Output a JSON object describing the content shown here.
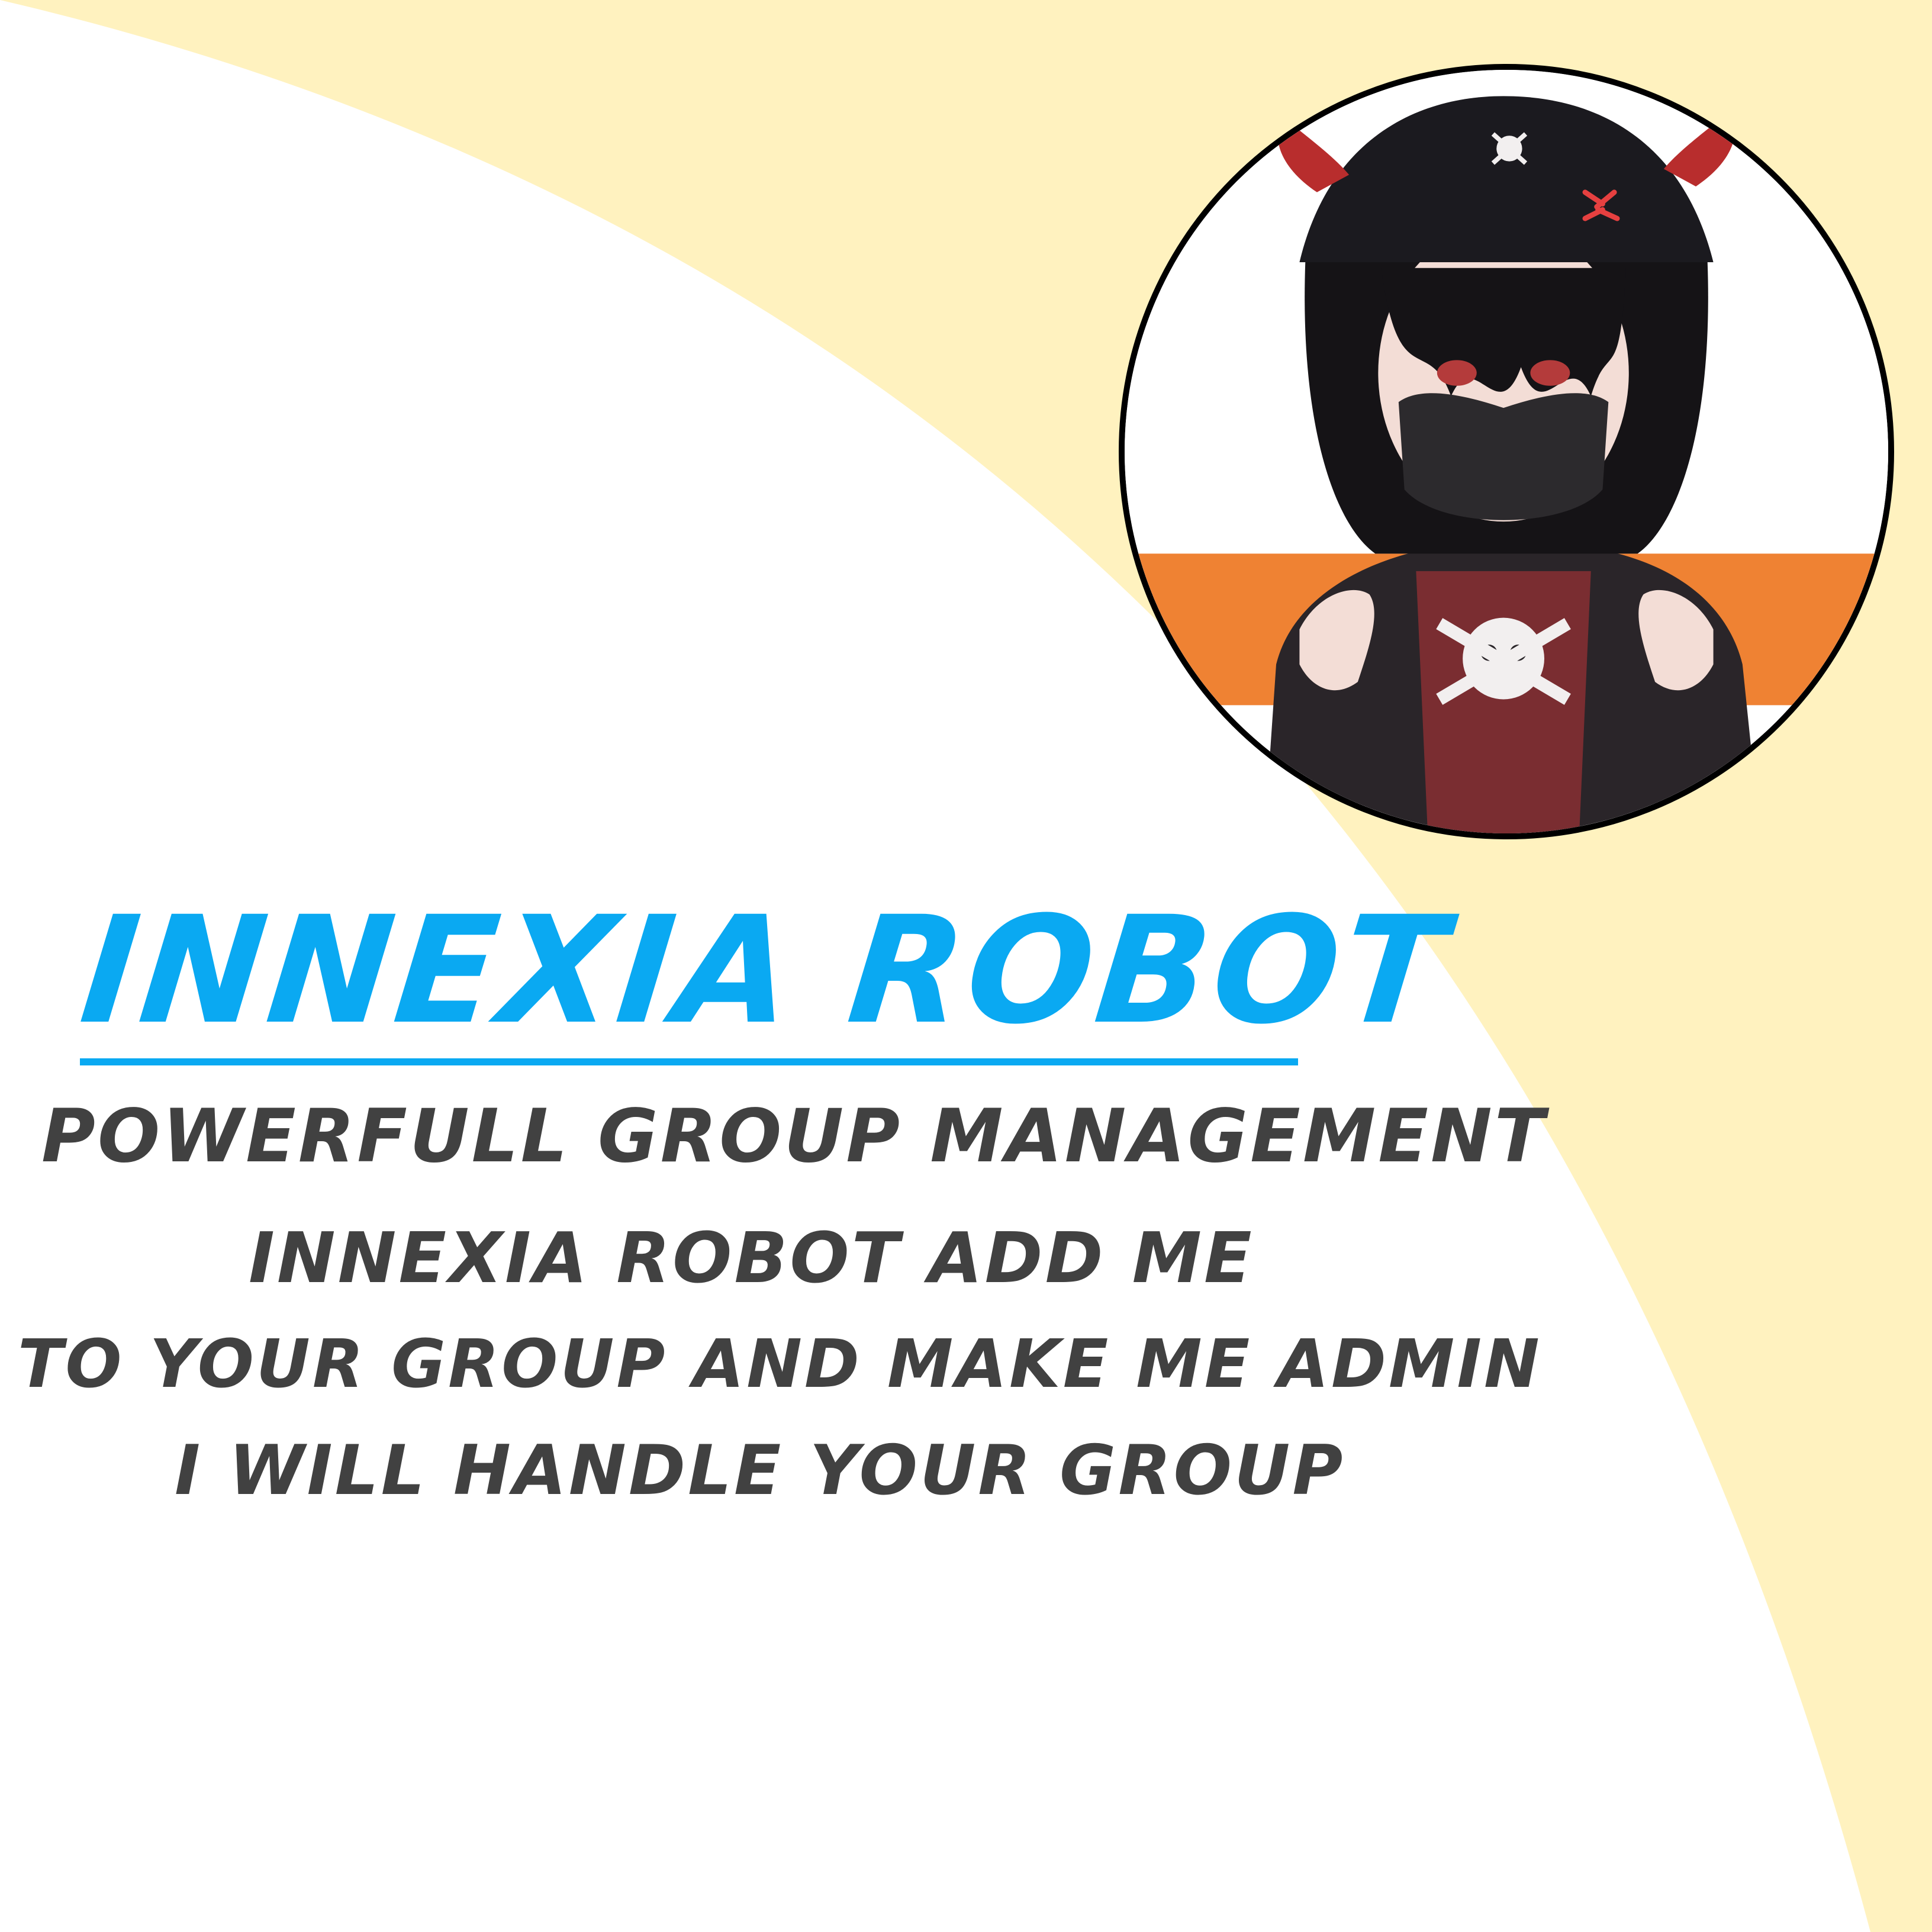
{
  "colors": {
    "background_cream": "#fff2bf",
    "background_white": "#ffffff",
    "title_blue": "#0aa9f2",
    "body_gray": "#414141",
    "avatar_border": "#000000",
    "avatar_stripe": "#ef8233"
  },
  "avatar": {
    "icon": "anime-girl-masked-hoodie-portrait"
  },
  "title": "INNEXIA ROBOT",
  "tagline": {
    "line1": "POWERFULL GROUP MANAGEMENT",
    "line2": "INNEXIA ROBOT ADD ME",
    "line3": "TO YOUR GROUP AND MAKE ME ADMIN",
    "line4": "I WILL HANDLE YOUR GROUP"
  }
}
